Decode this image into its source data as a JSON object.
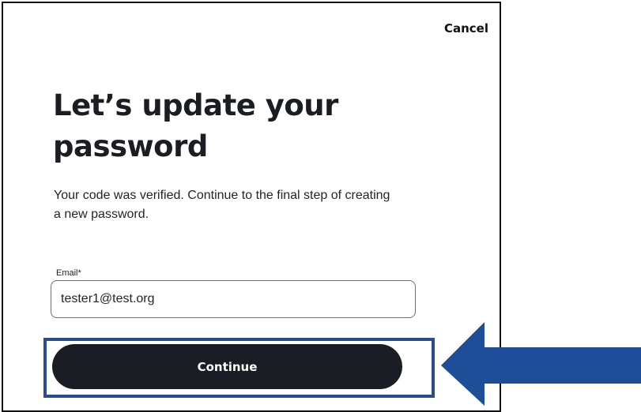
{
  "dialog": {
    "cancel_label": "Cancel",
    "title": "Let’s update your password",
    "subtitle": "Your code was verified. Continue to the final step of creating a new password.",
    "email_label": "Email*",
    "email_value": "tester1@test.org",
    "continue_label": "Continue"
  },
  "annotation": {
    "highlight_color": "#2a4d8f",
    "arrow_color": "#1f4e99",
    "arrow_icon": "arrow-left-icon"
  },
  "colors": {
    "button_bg": "#1a1e24",
    "text": "#1a1d22"
  }
}
